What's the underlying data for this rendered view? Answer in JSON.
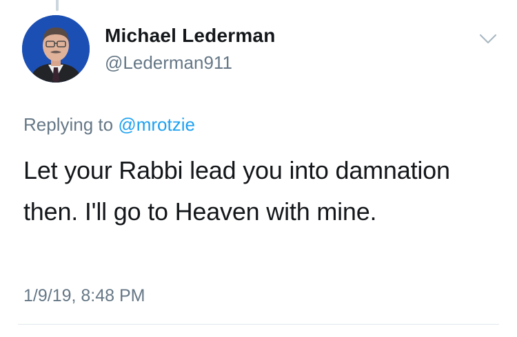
{
  "tweet": {
    "author": {
      "display_name": "Michael Lederman",
      "handle": "@Lederman911",
      "avatar_icon": "profile-photo"
    },
    "reply": {
      "prefix": "Replying to",
      "mention": "@mrotzie"
    },
    "text": "Let your Rabbi lead you into damnation then. I'll go to Heaven with mine.",
    "timestamp": "1/9/19, 8:48 PM",
    "menu_icon": "chevron-down-icon"
  },
  "colors": {
    "text_primary": "#14171a",
    "text_secondary": "#657786",
    "link": "#1da1f2",
    "divider": "#e1e8ed",
    "avatar_bg": "#1c4fb3"
  }
}
